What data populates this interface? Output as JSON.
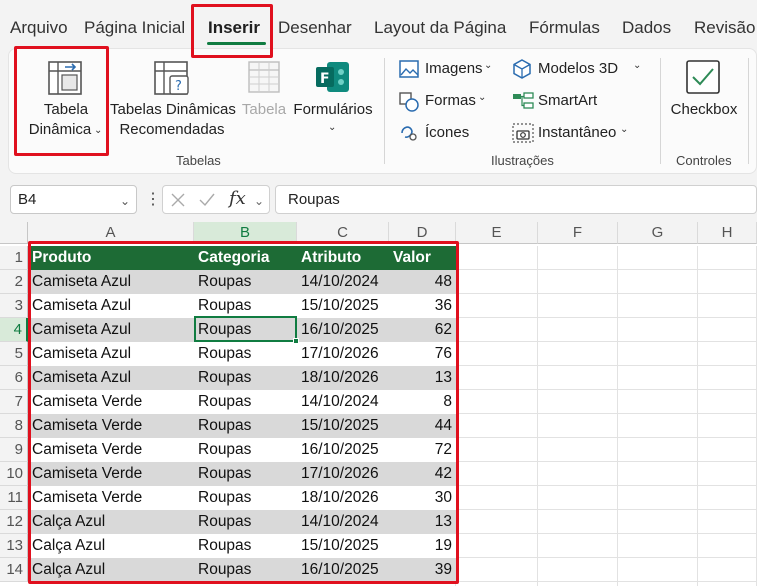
{
  "menu": {
    "tabs": [
      {
        "label": "Arquivo"
      },
      {
        "label": "Página Inicial"
      },
      {
        "label": "Inserir"
      },
      {
        "label": "Desenhar"
      },
      {
        "label": "Layout da Página"
      },
      {
        "label": "Fórmulas"
      },
      {
        "label": "Dados"
      },
      {
        "label": "Revisão"
      }
    ],
    "active": "Inserir"
  },
  "ribbon": {
    "tabelas": {
      "group_label": "Tabelas",
      "pivot_line1": "Tabela",
      "pivot_line2": "Dinâmica",
      "recommended_line1": "Tabelas Dinâmicas",
      "recommended_line2": "Recomendadas",
      "table": "Tabela",
      "forms": "Formulários"
    },
    "ilustracoes": {
      "group_label": "Ilustrações",
      "imagens": "Imagens",
      "formas": "Formas",
      "icones": "Ícones",
      "modelos3d": "Modelos 3D",
      "smartart": "SmartArt",
      "instantaneo": "Instantâneo"
    },
    "controles": {
      "group_label": "Controles",
      "checkbox": "Checkbox"
    },
    "colors": {
      "accent": "#107c41",
      "highlight": "#e0101e",
      "header_fill": "#1d6b35",
      "band_fill": "#d9d9d9"
    }
  },
  "formula_bar": {
    "name_box": "B4",
    "fx": "fx",
    "formula": "Roupas"
  },
  "grid": {
    "columns": [
      "A",
      "B",
      "C",
      "D",
      "E",
      "F",
      "G",
      "H"
    ],
    "rows": [
      "1",
      "2",
      "3",
      "4",
      "5",
      "6",
      "7",
      "8",
      "9",
      "10",
      "11",
      "12",
      "13",
      "14"
    ],
    "selected_column": "B",
    "selected_row": "4",
    "headers": [
      "Produto",
      "Categoria",
      "Atributo",
      "Valor"
    ],
    "data": [
      [
        "Camiseta Azul",
        "Roupas",
        "14/10/2024",
        "48"
      ],
      [
        "Camiseta Azul",
        "Roupas",
        "15/10/2025",
        "36"
      ],
      [
        "Camiseta Azul",
        "Roupas",
        "16/10/2025",
        "62"
      ],
      [
        "Camiseta Azul",
        "Roupas",
        "17/10/2026",
        "76"
      ],
      [
        "Camiseta Azul",
        "Roupas",
        "18/10/2026",
        "13"
      ],
      [
        "Camiseta Verde",
        "Roupas",
        "14/10/2024",
        "8"
      ],
      [
        "Camiseta Verde",
        "Roupas",
        "15/10/2025",
        "44"
      ],
      [
        "Camiseta Verde",
        "Roupas",
        "16/10/2025",
        "72"
      ],
      [
        "Camiseta Verde",
        "Roupas",
        "17/10/2026",
        "42"
      ],
      [
        "Camiseta Verde",
        "Roupas",
        "18/10/2026",
        "30"
      ],
      [
        "Calça Azul",
        "Roupas",
        "14/10/2024",
        "13"
      ],
      [
        "Calça Azul",
        "Roupas",
        "15/10/2025",
        "19"
      ],
      [
        "Calça Azul",
        "Roupas",
        "16/10/2025",
        "39"
      ]
    ]
  }
}
